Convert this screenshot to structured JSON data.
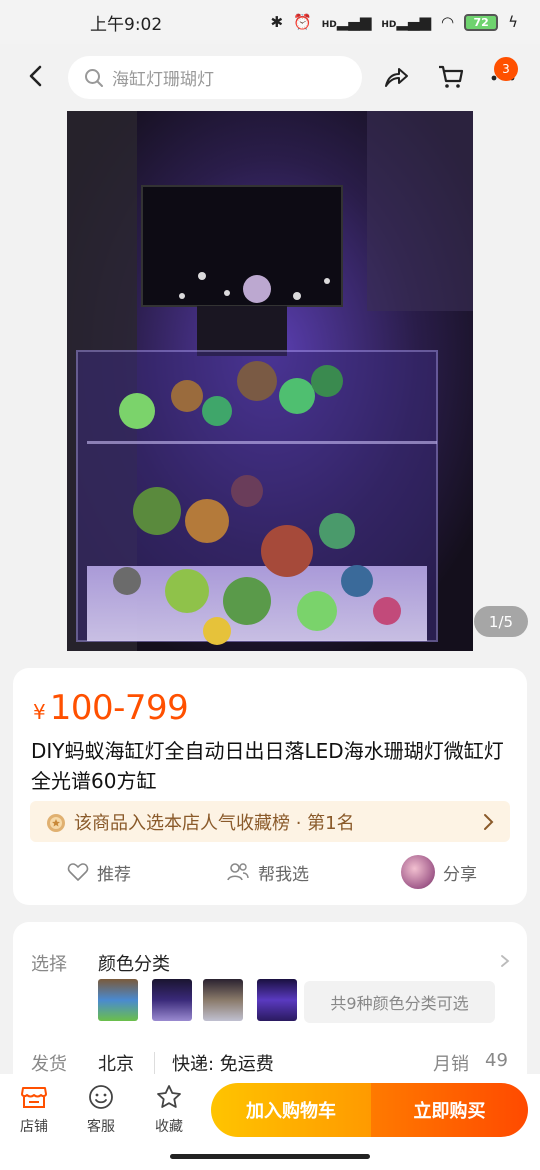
{
  "status_bar": {
    "time": "上午9:02",
    "battery": "72",
    "hd1": "HD",
    "hd2": "HD"
  },
  "search": {
    "placeholder": "海缸灯珊瑚灯"
  },
  "cart": {
    "badge": "3"
  },
  "gallery": {
    "counter": "1/5"
  },
  "product": {
    "currency": "¥",
    "price": "100-799",
    "title": "DIY蚂蚁海缸灯全自动日出日落LED海水珊瑚灯微缸灯 全光谱60方缸",
    "rank_text": "该商品入选本店人气收藏榜 · 第1名"
  },
  "actions": {
    "recommend": "推荐",
    "help_choose": "帮我选",
    "share": "分享"
  },
  "spec": {
    "select_label": "选择",
    "select_value": "颜色分类",
    "more_colors": "共9种颜色分类可选",
    "ship_label": "发货",
    "ship_from": "北京",
    "delivery": "快递: 免运费",
    "monthly_label": "月销",
    "monthly_sales": "49"
  },
  "bottom": {
    "shop": "店铺",
    "service": "客服",
    "favorite": "收藏",
    "add_cart": "加入购物车",
    "buy_now": "立即购买"
  },
  "colors": {
    "accent": "#ff5000",
    "cart_btn": "#ffb000",
    "buy_btn": "#ff5a00",
    "rank_bg": "#fdf3e4"
  }
}
